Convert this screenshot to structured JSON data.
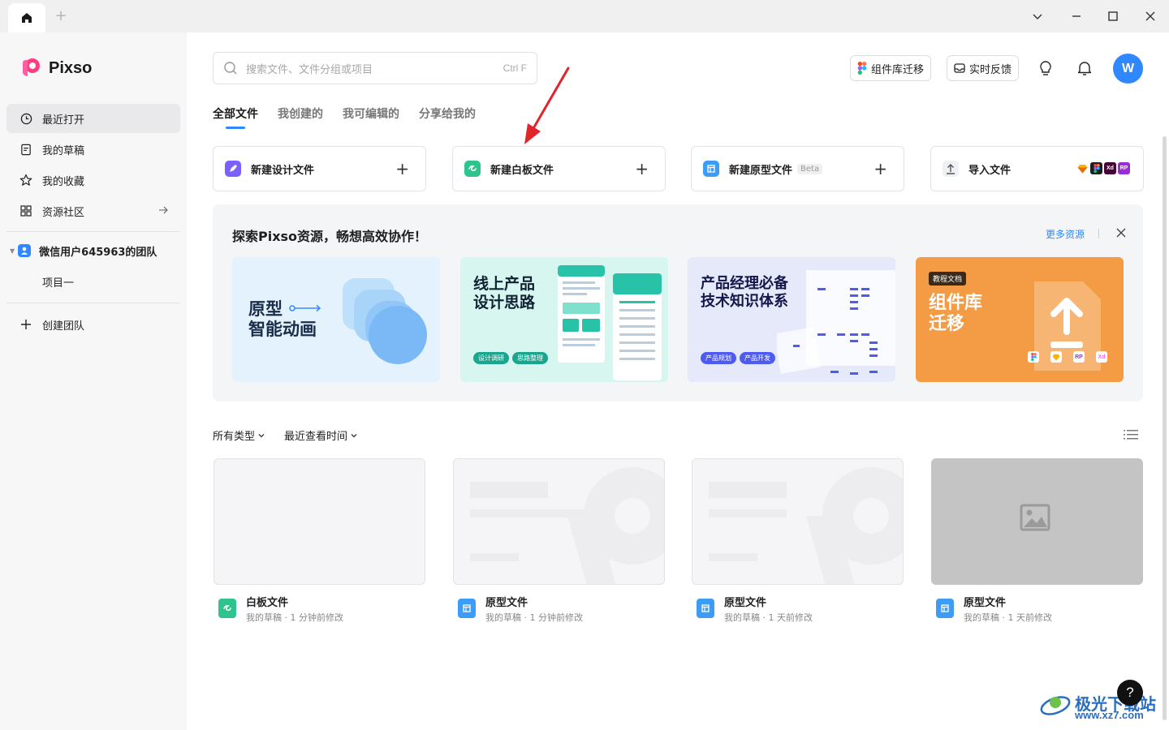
{
  "sidebar": {
    "logo": "Pixso",
    "items": [
      {
        "label": "最近打开"
      },
      {
        "label": "我的草稿"
      },
      {
        "label": "我的收藏"
      },
      {
        "label": "资源社区"
      }
    ],
    "team_name": "微信用户645963的团队",
    "project": "项目一",
    "create_team": "创建团队"
  },
  "search": {
    "placeholder": "搜索文件、文件分组或项目",
    "shortcut": "Ctrl F"
  },
  "header": {
    "migrate_btn": "组件库迁移",
    "feedback_btn": "实时反馈",
    "avatar_letter": "W"
  },
  "tabs": [
    {
      "label": "全部文件"
    },
    {
      "label": "我创建的"
    },
    {
      "label": "我可编辑的"
    },
    {
      "label": "分享给我的"
    }
  ],
  "new_cards": [
    {
      "label": "新建设计文件"
    },
    {
      "label": "新建白板文件"
    },
    {
      "label": "新建原型文件",
      "badge": "Beta"
    },
    {
      "label": "导入文件"
    }
  ],
  "import_formats": [
    "Xd",
    "RP"
  ],
  "resources": {
    "title": "探索Pixso资源，畅想高效协作！",
    "more": "更多资源",
    "cards": [
      {
        "title_line1": "原型",
        "title_line2": "智能动画"
      },
      {
        "title_line1": "线上产品",
        "title_line2": "设计思路",
        "tags": [
          "设计调研",
          "思路整理"
        ]
      },
      {
        "title_line1": "产品经理必备",
        "title_line2": "技术知识体系",
        "tags": [
          "产品规划",
          "产品开发"
        ]
      },
      {
        "badge": "教程文档",
        "title_line1": "组件库",
        "title_line2": "迁移",
        "formats": [
          "RP",
          "Xd"
        ]
      }
    ]
  },
  "filters": {
    "type": "所有类型",
    "sort": "最近查看时间"
  },
  "files": [
    {
      "name": "白板文件",
      "meta": "我的草稿 · 1 分钟前修改",
      "kind": "whiteboard"
    },
    {
      "name": "原型文件",
      "meta": "我的草稿 · 1 分钟前修改",
      "kind": "prototype"
    },
    {
      "name": "原型文件",
      "meta": "我的草稿 · 1 天前修改",
      "kind": "prototype"
    },
    {
      "name": "原型文件",
      "meta": "我的草稿 · 1 天前修改",
      "kind": "prototype"
    }
  ],
  "help": "?",
  "watermark": {
    "text": "极光下载站",
    "url": "www.xz7.com"
  },
  "colors": {
    "accent": "#2f88ff",
    "design": "#7b61ff",
    "whiteboard": "#2dc58d",
    "prototype": "#3d9cf5",
    "orange": "#f39b45"
  }
}
